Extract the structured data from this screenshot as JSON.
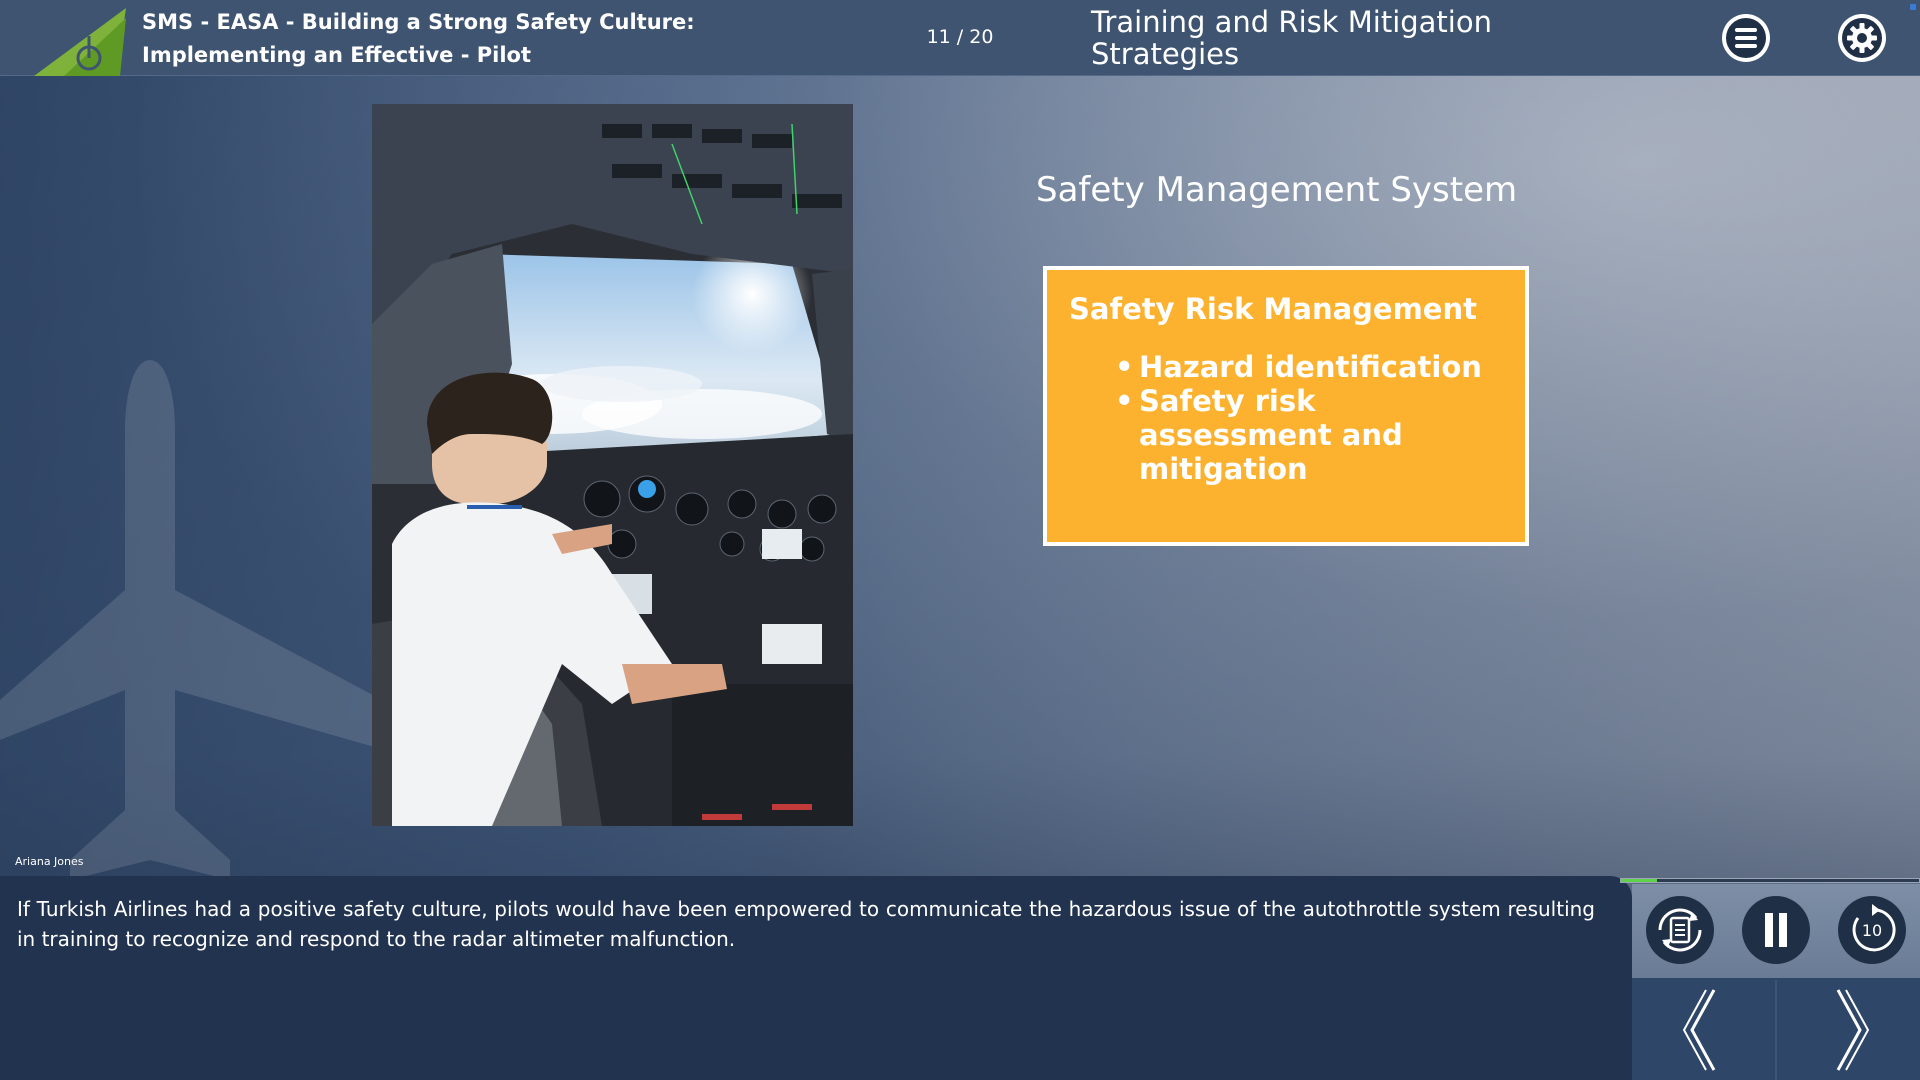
{
  "header": {
    "course_title_line1": "SMS - EASA - Building a Strong Safety Culture:",
    "course_title_line2": "Implementing an Effective - Pilot",
    "page_counter": "11 / 20",
    "section_title_line1": "Training and Risk Mitigation",
    "section_title_line2": "Strategies",
    "menu_icon": "hamburger-menu-icon",
    "settings_icon": "gear-icon"
  },
  "slide": {
    "heading": "Safety Management System",
    "photo_description_icon": "pilot-cockpit-photo",
    "box": {
      "title": "Safety Risk Management",
      "bullets": [
        "Hazard identification",
        "Safety risk assessment and mitigation"
      ]
    }
  },
  "narrator": "Ariana Jones",
  "caption": "If Turkish Airlines had a positive safety culture, pilots would have been empowered to communicate the hazardous issue of the autothrottle system resulting in training to recognize and respond to the radar altimeter malfunction.",
  "controls": {
    "progress_fraction": 0.12,
    "transcript_icon": "transcript-refresh-icon",
    "pause_icon": "pause-icon",
    "replay_icon": "replay-10-icon",
    "replay_label": "10",
    "prev_icon": "chevron-left-icon",
    "next_icon": "chevron-right-icon"
  },
  "colors": {
    "header_bg": "#3f5470",
    "box_bg": "#fdb22f",
    "caption_bg": "#223350",
    "progress": "#5fd14a",
    "logo_green": "#7fb23a"
  }
}
